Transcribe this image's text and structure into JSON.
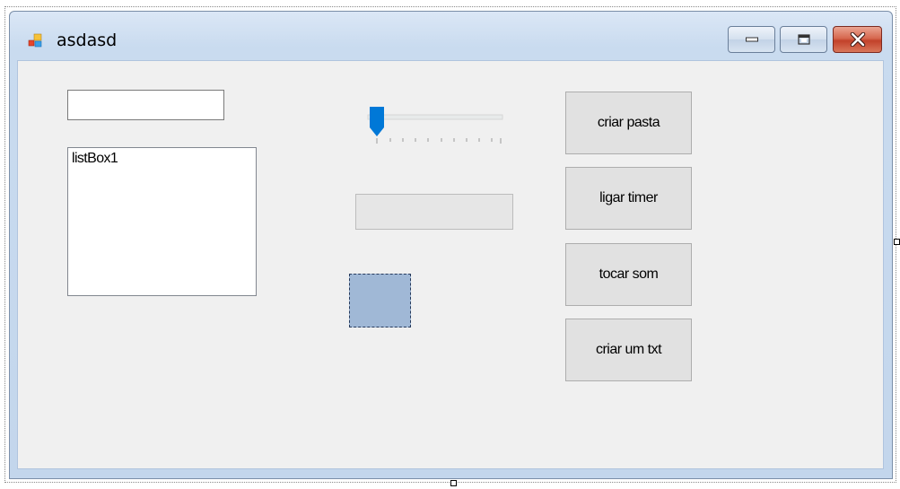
{
  "window": {
    "title": "asdasd",
    "controls": {
      "minimize": "minimize",
      "maximize": "maximize",
      "close": "close"
    }
  },
  "form": {
    "textbox": {
      "value": ""
    },
    "listbox": {
      "items": [
        "listBox1"
      ]
    },
    "trackbar": {
      "value": 0,
      "min": 0,
      "max": 10,
      "tick_count": 11,
      "accent": "#0078d7"
    },
    "progressbar": {
      "value": 0
    },
    "picturebox": {
      "color": "#a0b8d6"
    },
    "buttons": [
      {
        "label": "criar pasta"
      },
      {
        "label": "ligar timer"
      },
      {
        "label": "tocar som"
      },
      {
        "label": "criar um txt"
      }
    ]
  }
}
